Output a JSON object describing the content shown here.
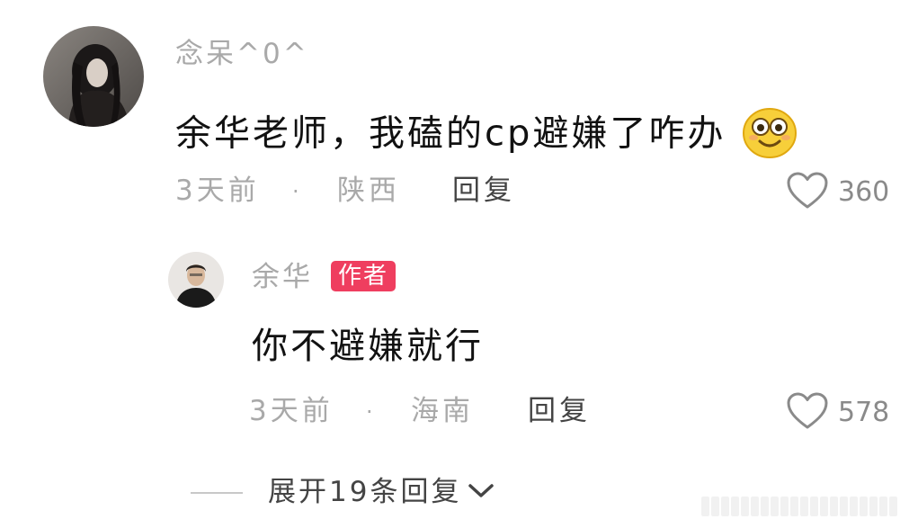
{
  "comment": {
    "username": "念呆^0^",
    "text": "余华老师，我磕的cp避嫌了咋办",
    "emoji": "smiling-face-emoji",
    "time": "3天前",
    "separator": "·",
    "location": "陕西",
    "reply_label": "回复",
    "likes": "360"
  },
  "reply": {
    "username": "余华",
    "badge": "作者",
    "text": "你不避嫌就行",
    "time": "3天前",
    "separator": "·",
    "location": "海南",
    "reply_label": "回复",
    "likes": "578"
  },
  "expand": {
    "label": "展开19条回复",
    "icon": "chevron-down-icon"
  },
  "colors": {
    "badge": "#ef3e5f",
    "muted_text": "#a9a9a9",
    "main_text": "#111111",
    "emoji_face": "#f7cf3a"
  }
}
